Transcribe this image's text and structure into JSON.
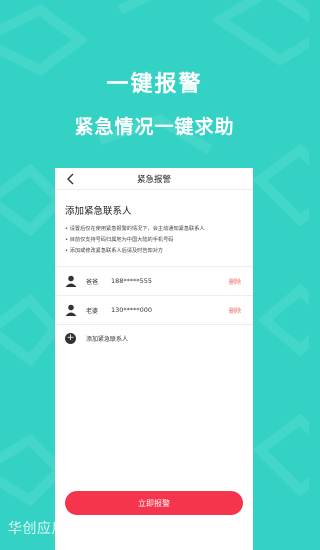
{
  "hero": {
    "title": "一键报警",
    "subtitle": "紧急情况一键求助"
  },
  "nav": {
    "title": "紧急报警",
    "back_icon": "chevron-left-icon"
  },
  "section": {
    "title": "添加紧急联系人",
    "notes": [
      "设置后仅在使用紧急报警的情况下，会主动通知紧急联系人",
      "目前仅支持号码归属地为中国大陆的手机号码",
      "添加或修改紧急联系人后请及时告知对方"
    ]
  },
  "contacts": [
    {
      "name": "爸爸",
      "phone": "188*****555",
      "delete_label": "删除"
    },
    {
      "name": "老婆",
      "phone": "130*****000",
      "delete_label": "删除"
    }
  ],
  "add_contact": {
    "label": "添加紧急联系人"
  },
  "alarm_button": {
    "label": "立即报警"
  },
  "watermark": "华创应用 · HUACHUANGYS.COM",
  "colors": {
    "background": "#33d2c4",
    "button": "#f5354d",
    "delete": "#f06060"
  }
}
